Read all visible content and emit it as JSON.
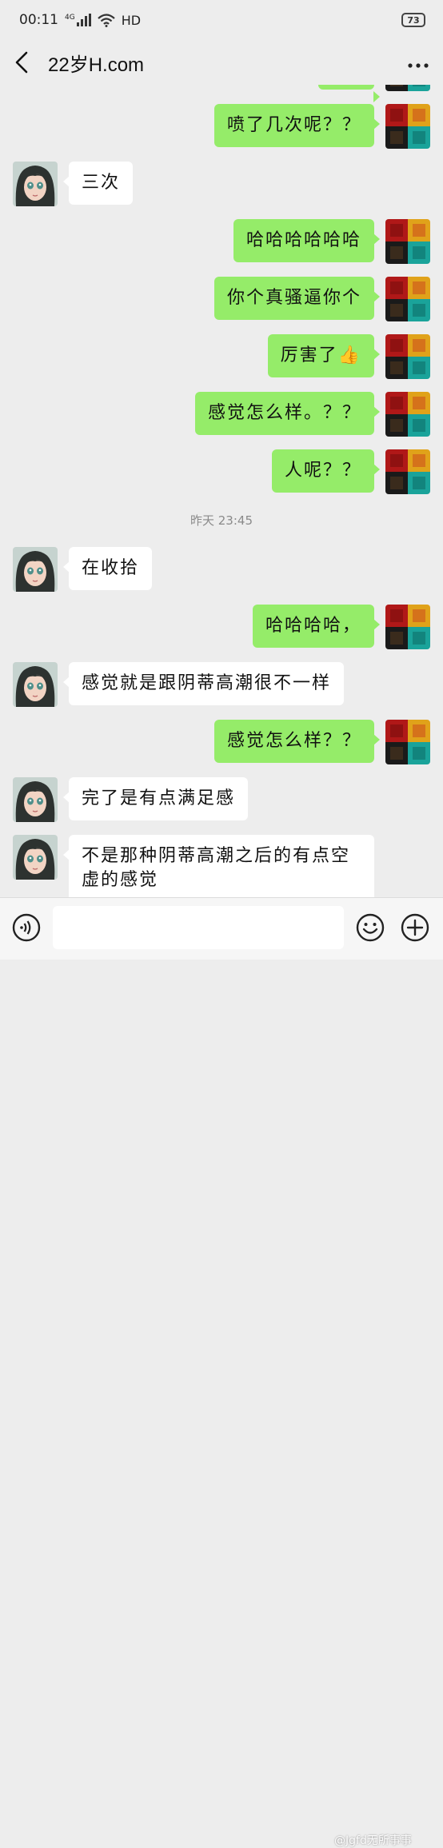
{
  "status_bar": {
    "time": "00:11",
    "network": "4G",
    "hd": "HD",
    "battery": "73"
  },
  "header": {
    "title": "22岁H.com",
    "more_icon": "more-dots-icon",
    "back_icon": "chevron-left-icon"
  },
  "colors": {
    "background": "#ededed",
    "outgoing_bubble": "#95ec69",
    "incoming_bubble": "#ffffff",
    "timestamp_text": "#8a8a8a"
  },
  "messages": [
    {
      "side": "out",
      "text": "喷了几次呢？？"
    },
    {
      "side": "in",
      "text": "三次"
    },
    {
      "side": "out",
      "text": "哈哈哈哈哈哈"
    },
    {
      "side": "out",
      "text": "你个真骚逼你个"
    },
    {
      "side": "out",
      "text": "厉害了",
      "emoji": "👍"
    },
    {
      "side": "out",
      "text": "感觉怎么样。？？"
    },
    {
      "side": "out",
      "text": "人呢？？"
    },
    {
      "side": "in",
      "text": "在收拾"
    },
    {
      "side": "out",
      "text": "哈哈哈哈，"
    },
    {
      "side": "in",
      "text": "感觉就是跟阴蒂高潮很不一样"
    },
    {
      "side": "out",
      "text": "感觉怎么样？？"
    },
    {
      "side": "in",
      "text": "完了是有点满足感"
    },
    {
      "side": "in",
      "text": "不是那种阴蒂高潮之后的有点空虚的感觉"
    }
  ],
  "timestamp": "昨天 23:45",
  "input_bar": {
    "voice_icon": "voice-icon",
    "emoji_icon": "emoji-smile-icon",
    "plus_icon": "plus-icon",
    "value": ""
  },
  "watermark": "@Jgfd无所事事"
}
